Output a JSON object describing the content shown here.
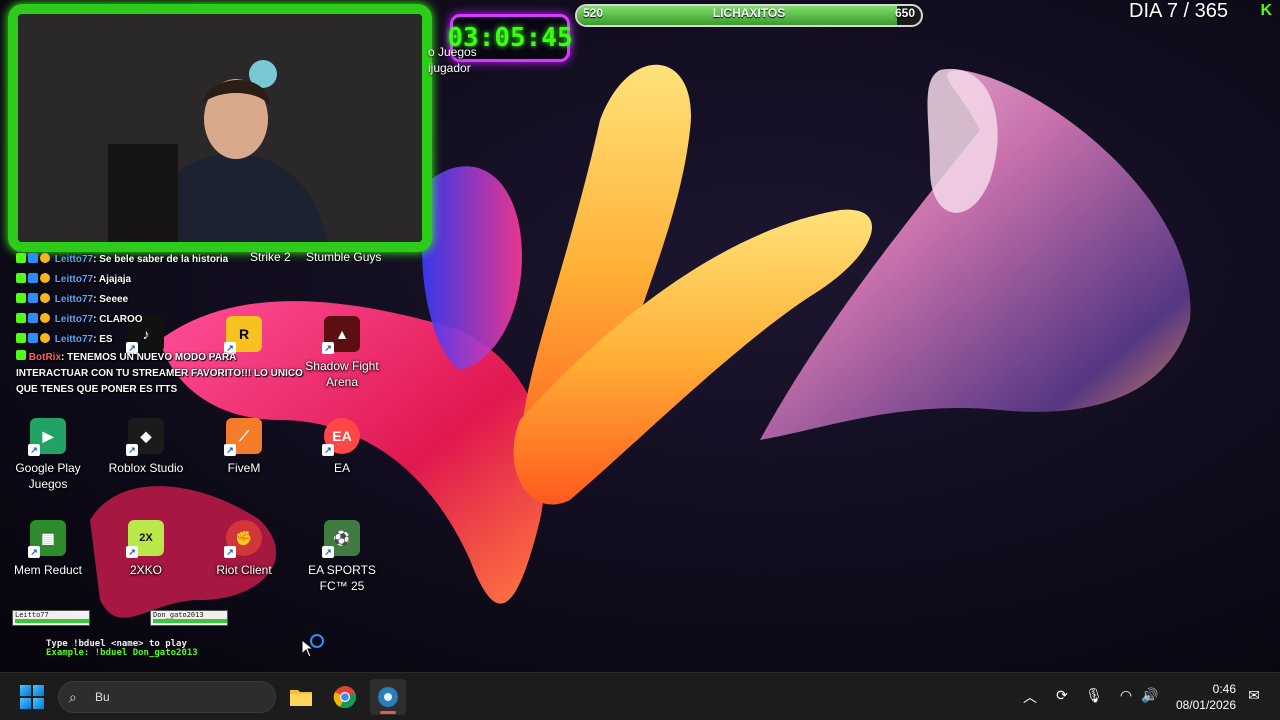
{
  "overlay": {
    "timer": "03:05:45",
    "goal": {
      "start": "520",
      "label": "LICHAXITOS",
      "end": "650",
      "progress": 0.93
    },
    "day_counter": "DIA 7 / 365",
    "kick_logo": "K"
  },
  "desktop_icons": [
    {
      "id": "steam-games",
      "label": "o Juegos\nijugador",
      "partial": true
    },
    {
      "id": "counter-strike-2",
      "label": "Strike 2",
      "partial": true
    },
    {
      "id": "stumble-guys",
      "label": "Stumble Guys",
      "partial": true
    },
    {
      "id": "shadow-fight-arena",
      "label": "Shadow Fight Arena",
      "icon": "shadow-fight-icon",
      "color": "#5a1010"
    },
    {
      "id": "google-play-games",
      "label": "Google Play Juegos",
      "icon": "google-play-icon",
      "color": "#21a366"
    },
    {
      "id": "roblox-studio",
      "label": "Roblox Studio",
      "icon": "roblox-icon",
      "color": "#1b1b1b"
    },
    {
      "id": "fivem",
      "label": "FiveM",
      "icon": "fivem-icon",
      "color": "#f57c2b"
    },
    {
      "id": "ea",
      "label": "EA",
      "icon": "ea-icon",
      "color": "#ff4747"
    },
    {
      "id": "mem-reduct",
      "label": "Mem Reduct",
      "icon": "memreduct-icon",
      "color": "#2d8b2d"
    },
    {
      "id": "2xko",
      "label": "2XKO",
      "icon": "2xko-icon",
      "color": "#b8e84a"
    },
    {
      "id": "riot-client",
      "label": "Riot Client",
      "icon": "riot-icon",
      "color": "#d13639"
    },
    {
      "id": "ea-sports-fc",
      "label": "EA SPORTS FC™ 25",
      "icon": "easportsfc-icon",
      "color": "#3f7a3f"
    },
    {
      "id": "rockstar-games",
      "label": "R",
      "icon": "rockstar-icon",
      "color": "#f7c21f"
    },
    {
      "id": "tiktok",
      "label": "",
      "icon": "tiktok-icon",
      "color": "#111"
    }
  ],
  "chat": {
    "messages": [
      {
        "user": "Leitto77",
        "text": ": Se bele saber de la historia"
      },
      {
        "user": "Leitto77",
        "text": ": Ajajaja"
      },
      {
        "user": "Leitto77",
        "text": ": Seeee"
      },
      {
        "user": "Leitto77",
        "text": ": CLAROO"
      },
      {
        "user": "Leitto77",
        "text": ": ES"
      }
    ],
    "bot": {
      "user": "BotRix",
      "text": ": TENEMOS UN NUEVO MODO PARA INTERACTUAR CON TU STREAMER FAVORITO!!! LO UNICO QUE TENES QUE PONER ES ITTS"
    }
  },
  "duel": {
    "player1": "Leitto77",
    "player2": "Don_gato2013",
    "help": "Type !bduel <name> to play",
    "example": "Example: !bduel Don_gato2013"
  },
  "taskbar": {
    "search_text": "Bu",
    "apps": [
      {
        "id": "file-explorer",
        "icon": "folder-icon"
      },
      {
        "id": "chrome",
        "icon": "chrome-icon"
      },
      {
        "id": "obs-like",
        "icon": "app-icon",
        "active": true
      }
    ],
    "time": "0:46",
    "date": "08/01/2026"
  }
}
